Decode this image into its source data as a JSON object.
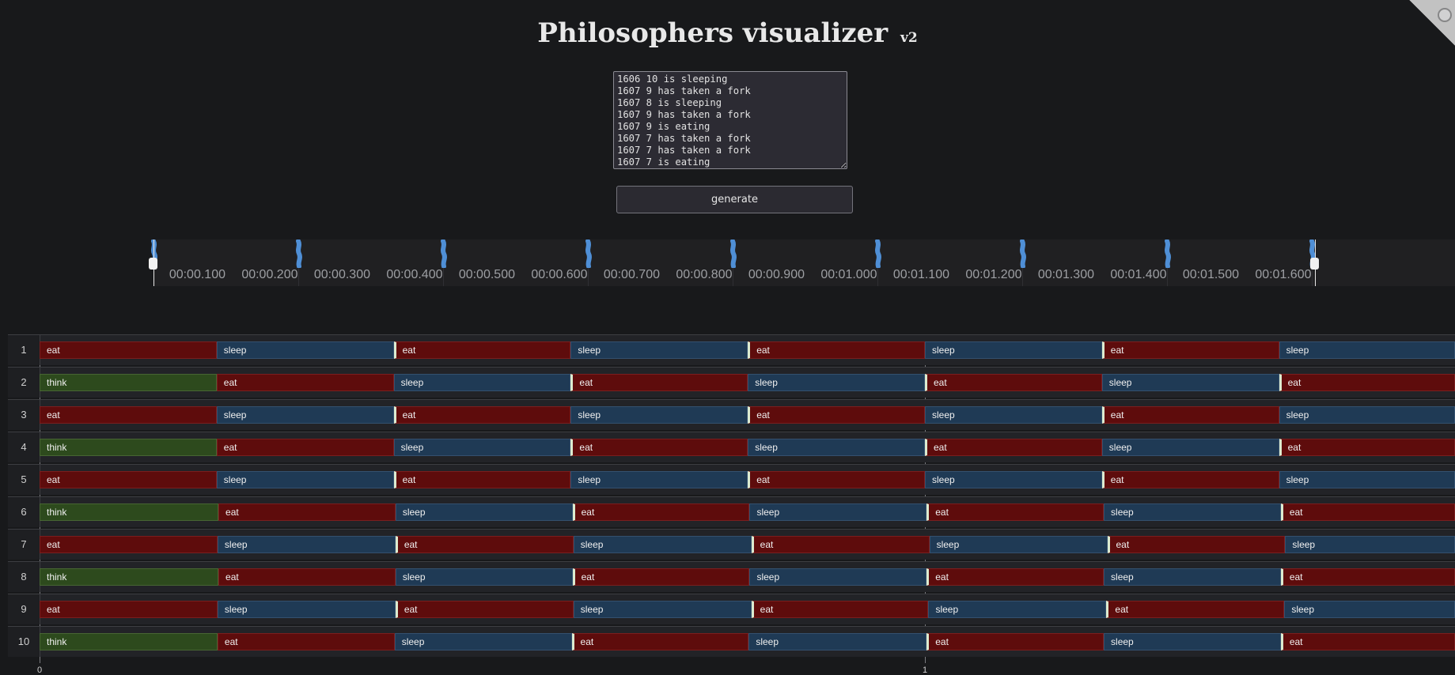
{
  "title": "Philosophers visualizer",
  "version": "v2",
  "log_text": "1606 10 is sleeping\n1607 9 has taken a fork\n1607 8 is sleeping\n1607 9 has taken a fork\n1607 9 is eating\n1607 7 has taken a fork\n1607 7 has taken a fork\n1607 7 is eating",
  "generate_label": "generate",
  "timeline_ticks": [
    "00:00.100",
    "00:00.200",
    "00:00.300",
    "00:00.400",
    "00:00.500",
    "00:00.600",
    "00:00.700",
    "00:00.800",
    "00:00.900",
    "00:01.000",
    "00:01.100",
    "00:01.200",
    "00:01.300",
    "00:01.400",
    "00:01.500",
    "00:01.600"
  ],
  "axis_labels": [
    "0",
    "1"
  ],
  "philosophers": [
    {
      "id": "1",
      "phases": [
        [
          "eat",
          0
        ],
        [
          "sleep",
          200
        ],
        [
          "eat",
          400
        ],
        [
          "sleep",
          600
        ],
        [
          "eat",
          800
        ],
        [
          "sleep",
          1000
        ],
        [
          "eat",
          1200
        ],
        [
          "sleep",
          1400
        ]
      ]
    },
    {
      "id": "2",
      "phases": [
        [
          "think",
          0
        ],
        [
          "eat",
          200
        ],
        [
          "sleep",
          400
        ],
        [
          "eat",
          600
        ],
        [
          "sleep",
          800
        ],
        [
          "eat",
          1000
        ],
        [
          "sleep",
          1200
        ],
        [
          "eat",
          1400
        ]
      ]
    },
    {
      "id": "3",
      "phases": [
        [
          "eat",
          0
        ],
        [
          "sleep",
          200
        ],
        [
          "eat",
          400
        ],
        [
          "sleep",
          600
        ],
        [
          "eat",
          800
        ],
        [
          "sleep",
          1000
        ],
        [
          "eat",
          1200
        ],
        [
          "sleep",
          1400
        ]
      ]
    },
    {
      "id": "4",
      "phases": [
        [
          "think",
          0
        ],
        [
          "eat",
          200
        ],
        [
          "sleep",
          400
        ],
        [
          "eat",
          600
        ],
        [
          "sleep",
          800
        ],
        [
          "eat",
          1000
        ],
        [
          "sleep",
          1200
        ],
        [
          "eat",
          1400
        ]
      ]
    },
    {
      "id": "5",
      "phases": [
        [
          "eat",
          0
        ],
        [
          "sleep",
          200
        ],
        [
          "eat",
          400
        ],
        [
          "sleep",
          600
        ],
        [
          "eat",
          800
        ],
        [
          "sleep",
          1000
        ],
        [
          "eat",
          1200
        ],
        [
          "sleep",
          1400
        ]
      ]
    },
    {
      "id": "6",
      "phases": [
        [
          "think",
          0
        ],
        [
          "eat",
          202
        ],
        [
          "sleep",
          402
        ],
        [
          "eat",
          602
        ],
        [
          "sleep",
          802
        ],
        [
          "eat",
          1002
        ],
        [
          "sleep",
          1202
        ],
        [
          "eat",
          1402
        ]
      ]
    },
    {
      "id": "7",
      "phases": [
        [
          "eat",
          0
        ],
        [
          "sleep",
          201
        ],
        [
          "eat",
          402
        ],
        [
          "sleep",
          603
        ],
        [
          "eat",
          804
        ],
        [
          "sleep",
          1005
        ],
        [
          "eat",
          1206
        ],
        [
          "sleep",
          1407
        ]
      ]
    },
    {
      "id": "8",
      "phases": [
        [
          "think",
          0
        ],
        [
          "eat",
          202
        ],
        [
          "sleep",
          402
        ],
        [
          "eat",
          602
        ],
        [
          "sleep",
          802
        ],
        [
          "eat",
          1002
        ],
        [
          "sleep",
          1202
        ],
        [
          "eat",
          1402
        ]
      ]
    },
    {
      "id": "9",
      "phases": [
        [
          "eat",
          0
        ],
        [
          "sleep",
          201
        ],
        [
          "eat",
          402
        ],
        [
          "sleep",
          603
        ],
        [
          "eat",
          804
        ],
        [
          "sleep",
          1004
        ],
        [
          "eat",
          1205
        ],
        [
          "sleep",
          1406
        ]
      ]
    },
    {
      "id": "10",
      "phases": [
        [
          "think",
          0
        ],
        [
          "eat",
          201
        ],
        [
          "sleep",
          401
        ],
        [
          "eat",
          601
        ],
        [
          "sleep",
          801
        ],
        [
          "eat",
          1002
        ],
        [
          "sleep",
          1202
        ],
        [
          "eat",
          1402
        ]
      ]
    }
  ]
}
